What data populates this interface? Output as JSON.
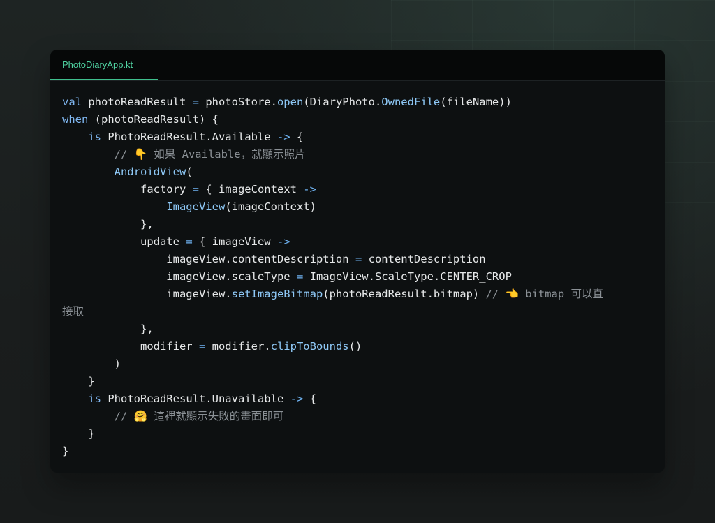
{
  "tab": {
    "filename": "PhotoDiaryApp.kt"
  },
  "code": {
    "lines": [
      [
        [
          "kw",
          "val"
        ],
        [
          "tx",
          " photoReadResult "
        ],
        [
          "op",
          "="
        ],
        [
          "tx",
          " photoStore."
        ],
        [
          "fn",
          "open"
        ],
        [
          "tx",
          "(DiaryPhoto."
        ],
        [
          "fn",
          "OwnedFile"
        ],
        [
          "tx",
          "(fileName))"
        ]
      ],
      [
        [
          "kw",
          "when"
        ],
        [
          "tx",
          " (photoReadResult) {"
        ]
      ],
      [
        [
          "tx",
          "    "
        ],
        [
          "kw",
          "is"
        ],
        [
          "tx",
          " PhotoReadResult.Available "
        ],
        [
          "op",
          "->"
        ],
        [
          "tx",
          " {"
        ]
      ],
      [
        [
          "tx",
          "        "
        ],
        [
          "cm",
          "// 👇 如果 Available，就顯示照片"
        ]
      ],
      [
        [
          "tx",
          "        "
        ],
        [
          "fn",
          "AndroidView"
        ],
        [
          "tx",
          "("
        ]
      ],
      [
        [
          "tx",
          "            factory "
        ],
        [
          "op",
          "="
        ],
        [
          "tx",
          " { imageContext "
        ],
        [
          "op",
          "->"
        ]
      ],
      [
        [
          "tx",
          "                "
        ],
        [
          "fn",
          "ImageView"
        ],
        [
          "tx",
          "(imageContext)"
        ]
      ],
      [
        [
          "tx",
          "            },"
        ]
      ],
      [
        [
          "tx",
          "            update "
        ],
        [
          "op",
          "="
        ],
        [
          "tx",
          " { imageView "
        ],
        [
          "op",
          "->"
        ]
      ],
      [
        [
          "tx",
          "                imageView.contentDescription "
        ],
        [
          "op",
          "="
        ],
        [
          "tx",
          " contentDescription"
        ]
      ],
      [
        [
          "tx",
          "                imageView.scaleType "
        ],
        [
          "op",
          "="
        ],
        [
          "tx",
          " ImageView.ScaleType.CENTER_CROP"
        ]
      ],
      [
        [
          "tx",
          "                imageView."
        ],
        [
          "fn",
          "setImageBitmap"
        ],
        [
          "tx",
          "(photoReadResult.bitmap) "
        ],
        [
          "cm",
          "// 👈 bitmap 可以直"
        ]
      ],
      [
        [
          "cm",
          "接取"
        ]
      ],
      [
        [
          "tx",
          "            },"
        ]
      ],
      [
        [
          "tx",
          "            modifier "
        ],
        [
          "op",
          "="
        ],
        [
          "tx",
          " modifier."
        ],
        [
          "fn",
          "clipToBounds"
        ],
        [
          "tx",
          "()"
        ]
      ],
      [
        [
          "tx",
          "        )"
        ]
      ],
      [
        [
          "tx",
          "    }"
        ]
      ],
      [
        [
          "tx",
          "    "
        ],
        [
          "kw",
          "is"
        ],
        [
          "tx",
          " PhotoReadResult.Unavailable "
        ],
        [
          "op",
          "->"
        ],
        [
          "tx",
          " {"
        ]
      ],
      [
        [
          "tx",
          "        "
        ],
        [
          "cm",
          "// 🤗 這裡就顯示失敗的畫面即可"
        ]
      ],
      [
        [
          "tx",
          "    }"
        ]
      ],
      [
        [
          "tx",
          "}"
        ]
      ]
    ]
  }
}
